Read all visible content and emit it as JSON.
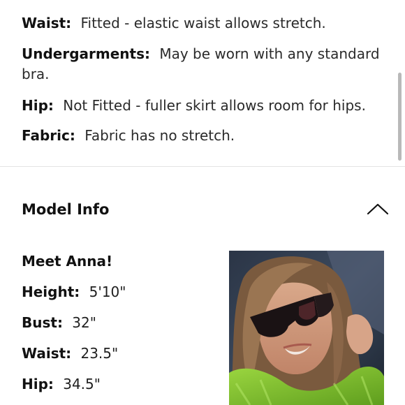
{
  "fit_details": [
    {
      "label": "Waist:",
      "value": "Fitted - elastic waist allows stretch."
    },
    {
      "label": "Undergarments:",
      "value": "May be worn with any standard"
    },
    {
      "label": "",
      "value": "bra."
    },
    {
      "label": "Hip:",
      "value": "Not Fitted - fuller skirt allows room for hips."
    },
    {
      "label": "Fabric:",
      "value": "Fabric has no stretch."
    }
  ],
  "model_info": {
    "title": "Model Info",
    "intro": "Meet Anna!",
    "stats": [
      {
        "label": "Height:",
        "value": "5'10\""
      },
      {
        "label": "Bust:",
        "value": "32\""
      },
      {
        "label": "Waist:",
        "value": "23.5\""
      },
      {
        "label": "Hip:",
        "value": "34.5\""
      }
    ],
    "toggle_icon": "chevron-up-icon"
  }
}
